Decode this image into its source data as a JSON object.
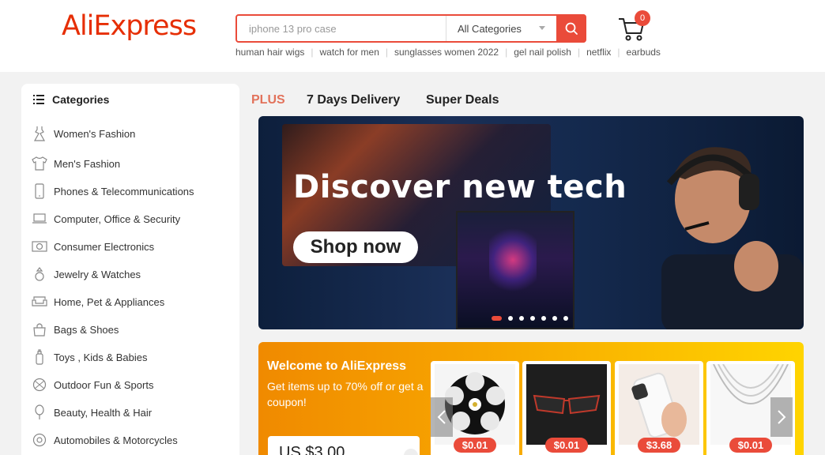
{
  "header": {
    "logo": "AliExpress",
    "search": {
      "placeholder": "iphone 13 pro case",
      "category": "All Categories"
    },
    "hot_keywords": [
      "human hair wigs",
      "watch for men",
      "sunglasses women 2022",
      "gel nail polish",
      "netflix",
      "earbuds"
    ],
    "cart_count": "0"
  },
  "sidebar": {
    "title": "Categories",
    "items": [
      {
        "label": "Women's Fashion",
        "icon": "dress-icon"
      },
      {
        "label": "Men's Fashion",
        "icon": "shirt-icon"
      },
      {
        "label": "Phones & Telecommunications",
        "icon": "phone-icon"
      },
      {
        "label": "Computer, Office & Security",
        "icon": "laptop-icon"
      },
      {
        "label": "Consumer Electronics",
        "icon": "camera-icon"
      },
      {
        "label": "Jewelry & Watches",
        "icon": "ring-icon"
      },
      {
        "label": "Home, Pet & Appliances",
        "icon": "sofa-icon"
      },
      {
        "label": "Bags & Shoes",
        "icon": "bag-icon"
      },
      {
        "label": "Toys , Kids & Babies",
        "icon": "bottle-icon"
      },
      {
        "label": "Outdoor Fun & Sports",
        "icon": "ball-icon"
      },
      {
        "label": "Beauty, Health & Hair",
        "icon": "mirror-icon"
      },
      {
        "label": "Automobiles & Motorcycles",
        "icon": "wheel-icon"
      }
    ]
  },
  "tabs": [
    "PLUS",
    "7 Days Delivery",
    "Super Deals"
  ],
  "banner": {
    "title": "Discover new tech",
    "cta": "Shop now",
    "slide_count": 7,
    "active_slide": 1
  },
  "welcome": {
    "title": "Welcome to AliExpress",
    "subtitle": "Get items up to 70% off or get a coupon!",
    "coupon": "US $3.00",
    "products": [
      {
        "price": "$0.01",
        "image": "eyelashes"
      },
      {
        "price": "$0.01",
        "image": "glasses"
      },
      {
        "price": "$3.68",
        "image": "phone-case"
      },
      {
        "price": "$0.01",
        "image": "necklace"
      }
    ]
  },
  "colors": {
    "brand": "#e62e04",
    "accent": "#ea4b3a",
    "plus": "#e2725b"
  }
}
